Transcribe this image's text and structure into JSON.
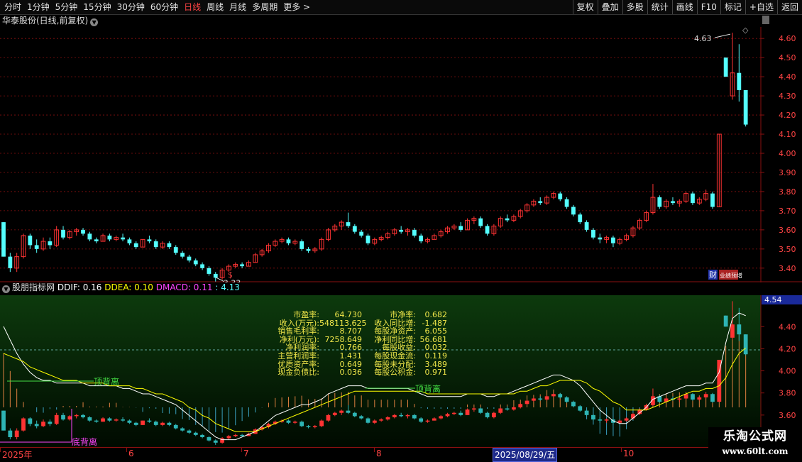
{
  "toolbar": {
    "tabs": [
      "分时",
      "1分钟",
      "5分钟",
      "15分钟",
      "30分钟",
      "60分钟",
      "日线",
      "周线",
      "月线",
      "多周期",
      "更多 >"
    ],
    "active_tab": "日线",
    "tools": [
      "复权",
      "叠加",
      "多股",
      "统计",
      "画线",
      "F10",
      "标记",
      "+自选",
      "返回"
    ]
  },
  "stock": {
    "title": "华泰股份(日线,前复权)",
    "high_label": "4.63",
    "low_label": "3.33",
    "s_marker": "$",
    "badge_cai": "财",
    "badge_zeng": "业绩预增"
  },
  "indicator": {
    "name": "股朋指标网",
    "ddif": "DDIF: 0.16",
    "ddea": "DDEA: 0.10",
    "dmacd": "DMACD: 0.11",
    "extra": ": 4.13",
    "top_divergence": "顶背离",
    "bottom_divergence": "底背离",
    "price_box": "4.54"
  },
  "financials": [
    {
      "k1": "市盈率:",
      "v1": "64.730",
      "k2": "市净率:",
      "v2": "0.682"
    },
    {
      "k1": "收入(万元):",
      "v1": "548113.625",
      "k2": "收入同比增:",
      "v2": "-1.487"
    },
    {
      "k1": "销售毛利率:",
      "v1": "8.707",
      "k2": "每股净资产:",
      "v2": "6.055"
    },
    {
      "k1": "净利(万元):",
      "v1": "7258.649",
      "k2": "净利同比增:",
      "v2": "56.681"
    },
    {
      "k1": "净利润率:",
      "v1": "0.766",
      "k2": "每股收益:",
      "v2": "0.032"
    },
    {
      "k1": "主营利润率:",
      "v1": "1.431",
      "k2": "每股现金流:",
      "v2": "0.119"
    },
    {
      "k1": "优质资产率:",
      "v1": "0.649",
      "k2": "每股未分配:",
      "v2": "3.489"
    },
    {
      "k1": "现金负债比:",
      "v1": "0.036",
      "k2": "每股公积金:",
      "v2": "0.971"
    }
  ],
  "axis": {
    "main_ticks": [
      "4.60",
      "4.50",
      "4.40",
      "4.30",
      "4.20",
      "4.10",
      "4.00",
      "3.90",
      "3.80",
      "3.70",
      "3.60",
      "3.50",
      "3.40"
    ],
    "ind_ticks": [
      "4.40",
      "4.20",
      "4.00",
      "3.80",
      "3.60"
    ]
  },
  "dates": {
    "labels": [
      "2025年",
      "6",
      "7",
      "8",
      "10"
    ],
    "cursor": "2025/08/29/五"
  },
  "watermark": {
    "line1": "乐淘公式网",
    "line2": "www.60lt.com"
  },
  "colors": {
    "up": "#ff3333",
    "down": "#54ffff",
    "grid": "#8a1010",
    "ddif": "#ffffff",
    "ddea": "#ffff00",
    "dmacd": "#ff44ff"
  },
  "chart_data": {
    "type": "candlestick",
    "y_range": [
      3.34,
      4.66
    ],
    "candles": [
      [
        3.64,
        3.64,
        3.46,
        3.46
      ],
      [
        3.46,
        3.48,
        3.38,
        3.4
      ],
      [
        3.4,
        3.48,
        3.38,
        3.46
      ],
      [
        3.46,
        3.58,
        3.45,
        3.57
      ],
      [
        3.57,
        3.58,
        3.5,
        3.52
      ],
      [
        3.52,
        3.55,
        3.48,
        3.5
      ],
      [
        3.5,
        3.56,
        3.49,
        3.54
      ],
      [
        3.54,
        3.56,
        3.5,
        3.52
      ],
      [
        3.52,
        3.62,
        3.51,
        3.6
      ],
      [
        3.6,
        3.62,
        3.55,
        3.56
      ],
      [
        3.56,
        3.6,
        3.55,
        3.59
      ],
      [
        3.59,
        3.61,
        3.57,
        3.6
      ],
      [
        3.6,
        3.61,
        3.57,
        3.58
      ],
      [
        3.58,
        3.59,
        3.54,
        3.55
      ],
      [
        3.55,
        3.56,
        3.53,
        3.54
      ],
      [
        3.54,
        3.58,
        3.54,
        3.57
      ],
      [
        3.57,
        3.58,
        3.54,
        3.55
      ],
      [
        3.55,
        3.57,
        3.54,
        3.56
      ],
      [
        3.56,
        3.58,
        3.54,
        3.55
      ],
      [
        3.55,
        3.56,
        3.52,
        3.53
      ],
      [
        3.53,
        3.54,
        3.5,
        3.51
      ],
      [
        3.51,
        3.55,
        3.51,
        3.55
      ],
      [
        3.55,
        3.57,
        3.53,
        3.54
      ],
      [
        3.54,
        3.55,
        3.5,
        3.51
      ],
      [
        3.51,
        3.54,
        3.5,
        3.53
      ],
      [
        3.53,
        3.54,
        3.5,
        3.51
      ],
      [
        3.51,
        3.52,
        3.47,
        3.48
      ],
      [
        3.48,
        3.49,
        3.45,
        3.46
      ],
      [
        3.46,
        3.47,
        3.43,
        3.44
      ],
      [
        3.44,
        3.45,
        3.41,
        3.42
      ],
      [
        3.42,
        3.43,
        3.39,
        3.4
      ],
      [
        3.4,
        3.41,
        3.36,
        3.37
      ],
      [
        3.37,
        3.38,
        3.33,
        3.35
      ],
      [
        3.35,
        3.4,
        3.34,
        3.39
      ],
      [
        3.39,
        3.42,
        3.38,
        3.41
      ],
      [
        3.41,
        3.43,
        3.4,
        3.42
      ],
      [
        3.42,
        3.43,
        3.4,
        3.41
      ],
      [
        3.41,
        3.44,
        3.41,
        3.43
      ],
      [
        3.43,
        3.48,
        3.43,
        3.47
      ],
      [
        3.47,
        3.5,
        3.46,
        3.49
      ],
      [
        3.49,
        3.53,
        3.48,
        3.52
      ],
      [
        3.52,
        3.55,
        3.51,
        3.54
      ],
      [
        3.54,
        3.56,
        3.53,
        3.55
      ],
      [
        3.55,
        3.56,
        3.52,
        3.53
      ],
      [
        3.53,
        3.55,
        3.52,
        3.54
      ],
      [
        3.54,
        3.55,
        3.49,
        3.5
      ],
      [
        3.5,
        3.51,
        3.48,
        3.49
      ],
      [
        3.49,
        3.51,
        3.48,
        3.5
      ],
      [
        3.5,
        3.56,
        3.49,
        3.55
      ],
      [
        3.55,
        3.61,
        3.54,
        3.6
      ],
      [
        3.6,
        3.63,
        3.59,
        3.62
      ],
      [
        3.62,
        3.65,
        3.6,
        3.64
      ],
      [
        3.64,
        3.69,
        3.61,
        3.62
      ],
      [
        3.62,
        3.63,
        3.58,
        3.59
      ],
      [
        3.59,
        3.6,
        3.56,
        3.57
      ],
      [
        3.57,
        3.58,
        3.52,
        3.53
      ],
      [
        3.53,
        3.56,
        3.52,
        3.55
      ],
      [
        3.55,
        3.57,
        3.54,
        3.56
      ],
      [
        3.56,
        3.59,
        3.55,
        3.58
      ],
      [
        3.58,
        3.61,
        3.57,
        3.6
      ],
      [
        3.6,
        3.62,
        3.58,
        3.59
      ],
      [
        3.59,
        3.61,
        3.57,
        3.6
      ],
      [
        3.6,
        3.61,
        3.56,
        3.57
      ],
      [
        3.57,
        3.58,
        3.53,
        3.54
      ],
      [
        3.54,
        3.56,
        3.53,
        3.55
      ],
      [
        3.55,
        3.58,
        3.55,
        3.57
      ],
      [
        3.57,
        3.6,
        3.56,
        3.59
      ],
      [
        3.59,
        3.62,
        3.58,
        3.61
      ],
      [
        3.61,
        3.63,
        3.6,
        3.62
      ],
      [
        3.62,
        3.64,
        3.59,
        3.6
      ],
      [
        3.6,
        3.66,
        3.6,
        3.65
      ],
      [
        3.65,
        3.67,
        3.63,
        3.66
      ],
      [
        3.66,
        3.67,
        3.61,
        3.62
      ],
      [
        3.62,
        3.63,
        3.57,
        3.58
      ],
      [
        3.58,
        3.63,
        3.57,
        3.62
      ],
      [
        3.62,
        3.67,
        3.61,
        3.66
      ],
      [
        3.66,
        3.68,
        3.64,
        3.65
      ],
      [
        3.65,
        3.68,
        3.64,
        3.67
      ],
      [
        3.67,
        3.71,
        3.66,
        3.7
      ],
      [
        3.7,
        3.74,
        3.69,
        3.73
      ],
      [
        3.73,
        3.76,
        3.72,
        3.75
      ],
      [
        3.75,
        3.77,
        3.73,
        3.74
      ],
      [
        3.74,
        3.78,
        3.73,
        3.77
      ],
      [
        3.77,
        3.8,
        3.76,
        3.79
      ],
      [
        3.79,
        3.8,
        3.75,
        3.76
      ],
      [
        3.76,
        3.77,
        3.71,
        3.72
      ],
      [
        3.72,
        3.73,
        3.67,
        3.68
      ],
      [
        3.68,
        3.69,
        3.63,
        3.64
      ],
      [
        3.64,
        3.65,
        3.59,
        3.6
      ],
      [
        3.6,
        3.61,
        3.55,
        3.56
      ],
      [
        3.56,
        3.58,
        3.53,
        3.55
      ],
      [
        3.55,
        3.57,
        3.53,
        3.56
      ],
      [
        3.56,
        3.57,
        3.51,
        3.53
      ],
      [
        3.53,
        3.56,
        3.52,
        3.55
      ],
      [
        3.55,
        3.58,
        3.54,
        3.57
      ],
      [
        3.57,
        3.62,
        3.56,
        3.61
      ],
      [
        3.61,
        3.66,
        3.6,
        3.65
      ],
      [
        3.65,
        3.7,
        3.64,
        3.69
      ],
      [
        3.69,
        3.84,
        3.68,
        3.77
      ],
      [
        3.77,
        3.78,
        3.71,
        3.72
      ],
      [
        3.72,
        3.76,
        3.71,
        3.75
      ],
      [
        3.75,
        3.77,
        3.73,
        3.74
      ],
      [
        3.74,
        3.76,
        3.72,
        3.75
      ],
      [
        3.75,
        3.8,
        3.74,
        3.79
      ],
      [
        3.79,
        3.8,
        3.73,
        3.74
      ],
      [
        3.74,
        3.77,
        3.73,
        3.76
      ],
      [
        3.76,
        3.81,
        3.75,
        3.79
      ],
      [
        3.79,
        3.8,
        3.71,
        3.72
      ],
      [
        3.72,
        4.1,
        3.72,
        4.1
      ],
      [
        4.5,
        4.5,
        4.4,
        4.4
      ],
      [
        4.3,
        4.63,
        4.28,
        4.42
      ],
      [
        4.42,
        4.57,
        4.27,
        4.33
      ],
      [
        4.33,
        4.33,
        4.14,
        4.15
      ]
    ],
    "ddif": [
      0.3,
      0.25,
      0.2,
      0.16,
      0.13,
      0.11,
      0.1,
      0.1,
      0.09,
      0.09,
      0.09,
      0.09,
      0.09,
      0.08,
      0.08,
      0.08,
      0.08,
      0.08,
      0.07,
      0.07,
      0.06,
      0.05,
      0.05,
      0.04,
      0.03,
      0.02,
      0.01,
      -0.01,
      -0.03,
      -0.05,
      -0.07,
      -0.09,
      -0.11,
      -0.12,
      -0.12,
      -0.12,
      -0.11,
      -0.1,
      -0.09,
      -0.07,
      -0.05,
      -0.03,
      -0.02,
      -0.01,
      0.0,
      0.01,
      0.01,
      0.02,
      0.03,
      0.05,
      0.06,
      0.07,
      0.08,
      0.08,
      0.08,
      0.07,
      0.07,
      0.07,
      0.07,
      0.07,
      0.07,
      0.07,
      0.06,
      0.05,
      0.04,
      0.04,
      0.04,
      0.04,
      0.04,
      0.04,
      0.05,
      0.05,
      0.05,
      0.04,
      0.04,
      0.05,
      0.05,
      0.06,
      0.07,
      0.08,
      0.09,
      0.1,
      0.11,
      0.12,
      0.12,
      0.11,
      0.1,
      0.08,
      0.05,
      0.02,
      -0.01,
      -0.03,
      -0.05,
      -0.06,
      -0.06,
      -0.04,
      -0.02,
      0.0,
      0.03,
      0.04,
      0.05,
      0.06,
      0.07,
      0.08,
      0.08,
      0.08,
      0.09,
      0.09,
      0.13,
      0.24,
      0.33,
      0.35,
      0.34
    ],
    "ddea": [
      0.2,
      0.19,
      0.18,
      0.17,
      0.15,
      0.14,
      0.13,
      0.12,
      0.11,
      0.1,
      0.1,
      0.1,
      0.09,
      0.09,
      0.09,
      0.09,
      0.08,
      0.08,
      0.08,
      0.08,
      0.07,
      0.07,
      0.06,
      0.05,
      0.05,
      0.04,
      0.03,
      0.02,
      0.0,
      -0.01,
      -0.03,
      -0.04,
      -0.06,
      -0.07,
      -0.08,
      -0.09,
      -0.09,
      -0.09,
      -0.09,
      -0.08,
      -0.07,
      -0.06,
      -0.05,
      -0.04,
      -0.03,
      -0.02,
      -0.01,
      0.0,
      0.01,
      0.02,
      0.03,
      0.04,
      0.05,
      0.06,
      0.06,
      0.06,
      0.06,
      0.06,
      0.06,
      0.06,
      0.06,
      0.06,
      0.06,
      0.06,
      0.05,
      0.05,
      0.05,
      0.05,
      0.05,
      0.05,
      0.05,
      0.05,
      0.05,
      0.05,
      0.05,
      0.05,
      0.05,
      0.05,
      0.06,
      0.06,
      0.07,
      0.08,
      0.08,
      0.09,
      0.1,
      0.1,
      0.1,
      0.1,
      0.09,
      0.07,
      0.06,
      0.04,
      0.02,
      0.01,
      -0.01,
      -0.01,
      -0.01,
      -0.01,
      0.0,
      0.01,
      0.02,
      0.03,
      0.04,
      0.05,
      0.06,
      0.06,
      0.07,
      0.07,
      0.08,
      0.11,
      0.16,
      0.2,
      0.22
    ]
  }
}
